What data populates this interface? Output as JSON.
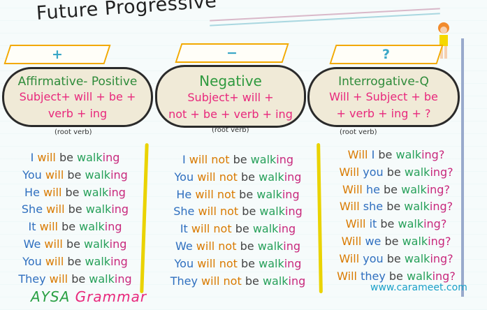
{
  "title": "Future Progressive",
  "signs": {
    "positive": "+",
    "negative": "−",
    "question": "?"
  },
  "bubbles": {
    "affirmative": {
      "heading": "Affirmative- Positive",
      "line1": "Subject+ will + be +",
      "line2": "verb + ing",
      "root": "(root verb)"
    },
    "negative": {
      "heading": "Negative",
      "line1": "Subject+ will +",
      "line2": "not + be + verb + ing",
      "root": "(root verb)"
    },
    "interrogative": {
      "heading": "Interrogative-Q",
      "line1": "Will + Subject + be",
      "line2": "+ verb + ing + ?",
      "root": "(root verb)"
    }
  },
  "affirmative_rows": [
    {
      "pro": "I",
      "will": "will",
      "be": "be",
      "verb": "walk",
      "ing": "ing"
    },
    {
      "pro": "You",
      "will": "will",
      "be": "be",
      "verb": "walk",
      "ing": "ing"
    },
    {
      "pro": "He",
      "will": "will",
      "be": "be",
      "verb": "walk",
      "ing": "ing"
    },
    {
      "pro": "She",
      "will": "will",
      "be": "be",
      "verb": "walk",
      "ing": "ing"
    },
    {
      "pro": "It",
      "will": "will",
      "be": "be",
      "verb": "walk",
      "ing": "ing"
    },
    {
      "pro": "We",
      "will": "will",
      "be": "be",
      "verb": "walk",
      "ing": "ing"
    },
    {
      "pro": "You",
      "will": "will",
      "be": "be",
      "verb": "walk",
      "ing": "ing"
    },
    {
      "pro": "They",
      "will": "will",
      "be": "be",
      "verb": "walk",
      "ing": "ing"
    }
  ],
  "negative_rows": [
    {
      "pro": "I",
      "will": "will not",
      "be": "be",
      "verb": "walk",
      "ing": "ing"
    },
    {
      "pro": "You",
      "will": "will not",
      "be": "be",
      "verb": "walk",
      "ing": "ing"
    },
    {
      "pro": "He",
      "will": "will not",
      "be": "be",
      "verb": "walk",
      "ing": "ing"
    },
    {
      "pro": "She",
      "will": "will not",
      "be": "be",
      "verb": "walk",
      "ing": "ing"
    },
    {
      "pro": "It",
      "will": "will not",
      "be": "be",
      "verb": "walk",
      "ing": "ing"
    },
    {
      "pro": "We",
      "will": "will not",
      "be": "be",
      "verb": "walk",
      "ing": "ing"
    },
    {
      "pro": "You",
      "will": "will not",
      "be": "be",
      "verb": "walk",
      "ing": "ing"
    },
    {
      "pro": "They",
      "will": "will not",
      "be": "be",
      "verb": "walk",
      "ing": "ing"
    }
  ],
  "question_rows": [
    {
      "will": "Will",
      "pro": "I",
      "be": "be",
      "verb": "walk",
      "ing": "ing?"
    },
    {
      "will": "Will",
      "pro": "you",
      "be": "be",
      "verb": "walk",
      "ing": "ing?"
    },
    {
      "will": "Will",
      "pro": "he",
      "be": "be",
      "verb": "walk",
      "ing": "ing?"
    },
    {
      "will": "Will",
      "pro": "she",
      "be": "be",
      "verb": "walk",
      "ing": "ing?"
    },
    {
      "will": "Will",
      "pro": "it",
      "be": "be",
      "verb": "walk",
      "ing": "ing?"
    },
    {
      "will": "Will",
      "pro": "we",
      "be": "be",
      "verb": "walk",
      "ing": "ing?"
    },
    {
      "will": "Will",
      "pro": "you",
      "be": "be",
      "verb": "walk",
      "ing": "ing?"
    },
    {
      "will": "Will",
      "pro": "they",
      "be": "be",
      "verb": "walk",
      "ing": "ing?"
    }
  ],
  "brand": {
    "part1": "AYSA",
    "part2": "Grammar"
  },
  "website": "www.carameet.com"
}
